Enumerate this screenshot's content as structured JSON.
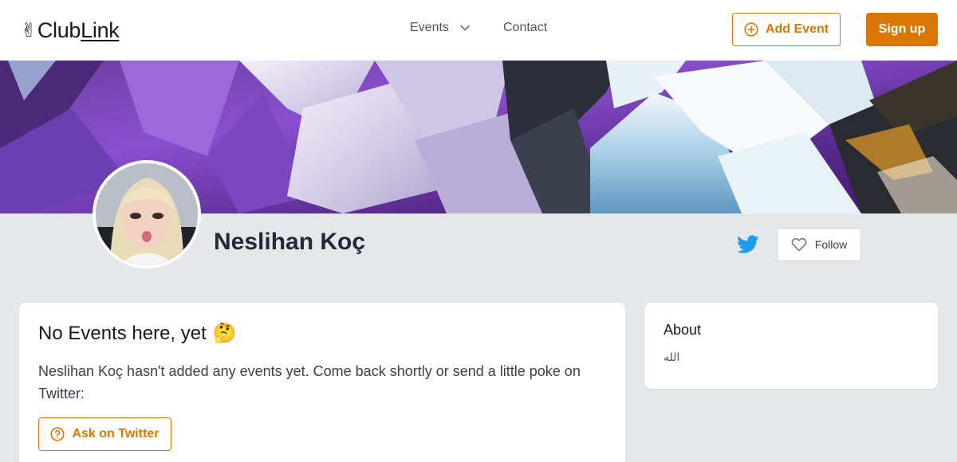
{
  "header": {
    "logo_emoji": "✌",
    "logo_club": "Club",
    "logo_link": "Link",
    "nav_events": "Events",
    "nav_contact": "Contact",
    "add_event_label": "Add Event",
    "signup_label": "Sign up"
  },
  "profile": {
    "name": "Neslihan Koç",
    "follow_label": "Follow"
  },
  "events_card": {
    "title": "No Events here, yet",
    "title_emoji": "🤔",
    "message": "Neslihan Koç hasn't added any events yet. Come back shortly or send a little poke on Twitter:",
    "ask_button_label": "Ask on Twitter"
  },
  "about_card": {
    "title": "About",
    "text": "الله"
  },
  "colors": {
    "accent": "#d97706",
    "twitter": "#1d9bf0",
    "page_bg": "#e5e7eb"
  },
  "icons": {
    "add_event": "plus-circle-icon",
    "events_dropdown": "chevron-down-icon",
    "twitter": "twitter-icon",
    "follow": "heart-icon",
    "ask": "question-circle-icon"
  }
}
